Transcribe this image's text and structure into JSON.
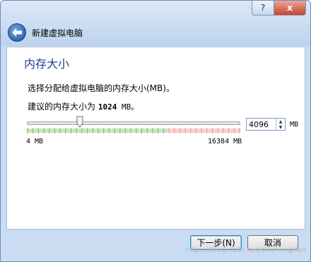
{
  "titlebar": {
    "help_label": "?",
    "close_label": "x"
  },
  "header": {
    "title": "新建虚拟电脑"
  },
  "page": {
    "title": "内存大小",
    "instruction": "选择分配给虚拟电脑的内存大小(MB)。",
    "recommend_prefix": "建议的内存大小为 ",
    "recommend_value": "1024",
    "recommend_suffix": " MB。"
  },
  "memory": {
    "min_label": "4 MB",
    "max_label": "16384 MB",
    "value": "4096",
    "unit": "MB",
    "min_mb": 4,
    "max_mb": 16384,
    "current_mb": 4096,
    "safe_fraction": 0.66
  },
  "buttons": {
    "next": "下一步(N)",
    "cancel": "取消"
  },
  "watermark": "https://blog.csdn.net/shizhongtian",
  "colors": {
    "title_blue": "#1e3f8c",
    "safe_tick": "#9fd08a",
    "unsafe_tick": "#f0a8a8"
  }
}
